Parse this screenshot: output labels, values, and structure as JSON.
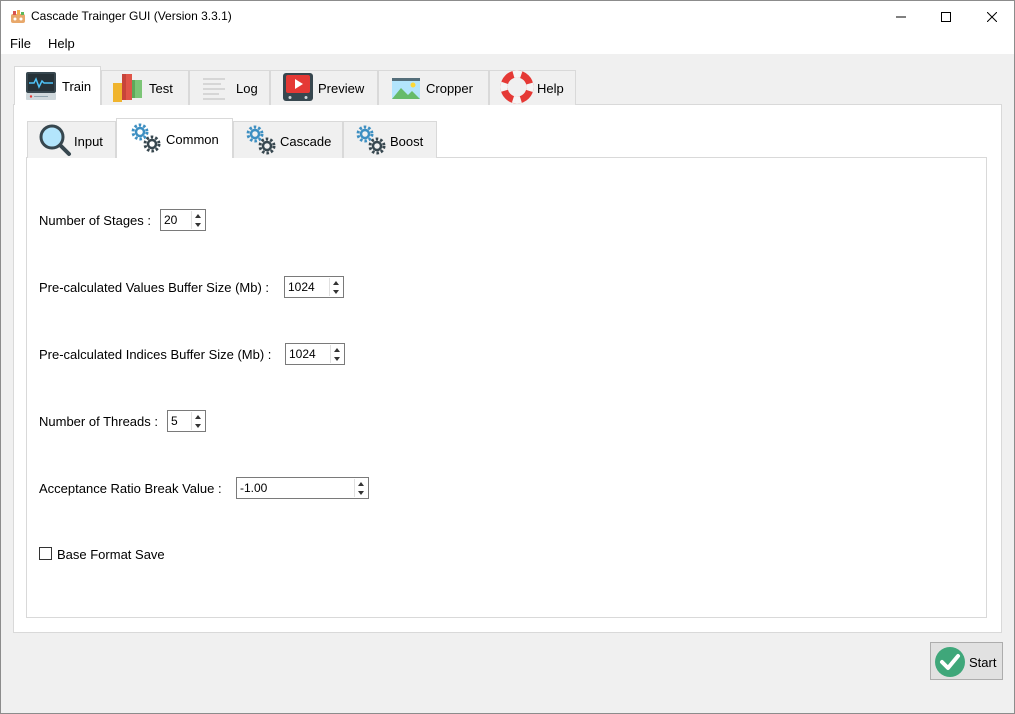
{
  "window": {
    "title": "Cascade Trainger GUI (Version 3.3.1)"
  },
  "menu": {
    "file": "File",
    "help": "Help"
  },
  "outer_tabs": [
    {
      "label": "Train",
      "icon": "monitor-icon",
      "active": true
    },
    {
      "label": "Test",
      "icon": "blocks-icon",
      "active": false
    },
    {
      "label": "Log",
      "icon": "log-icon",
      "active": false
    },
    {
      "label": "Preview",
      "icon": "play-icon",
      "active": false
    },
    {
      "label": "Cropper",
      "icon": "image-icon",
      "active": false
    },
    {
      "label": "Help",
      "icon": "lifebuoy-icon",
      "active": false
    }
  ],
  "inner_tabs": [
    {
      "label": "Input",
      "icon": "magnifier-icon",
      "active": false
    },
    {
      "label": "Common",
      "icon": "gears-icon",
      "active": true
    },
    {
      "label": "Cascade",
      "icon": "gears-icon",
      "active": false
    },
    {
      "label": "Boost",
      "icon": "gears-icon",
      "active": false
    }
  ],
  "fields": {
    "stages": {
      "label": "Number of Stages :",
      "value": "20"
    },
    "values_buffer": {
      "label": "Pre-calculated Values Buffer Size (Mb) :",
      "value": "1024"
    },
    "indices_buffer": {
      "label": "Pre-calculated Indices Buffer Size (Mb) :",
      "value": "1024"
    },
    "threads": {
      "label": "Number of Threads :",
      "value": "5"
    },
    "acceptance": {
      "label": "Acceptance Ratio Break Value :",
      "value": "-1.00"
    }
  },
  "base_format_save": {
    "label": "Base Format Save",
    "checked": false
  },
  "start_button": {
    "label": "Start"
  },
  "colors": {
    "accent_green": "#3fa77a",
    "tab_border": "#d9d9d9",
    "gear_blue": "#3d8fc2",
    "gear_dark": "#37474f"
  }
}
